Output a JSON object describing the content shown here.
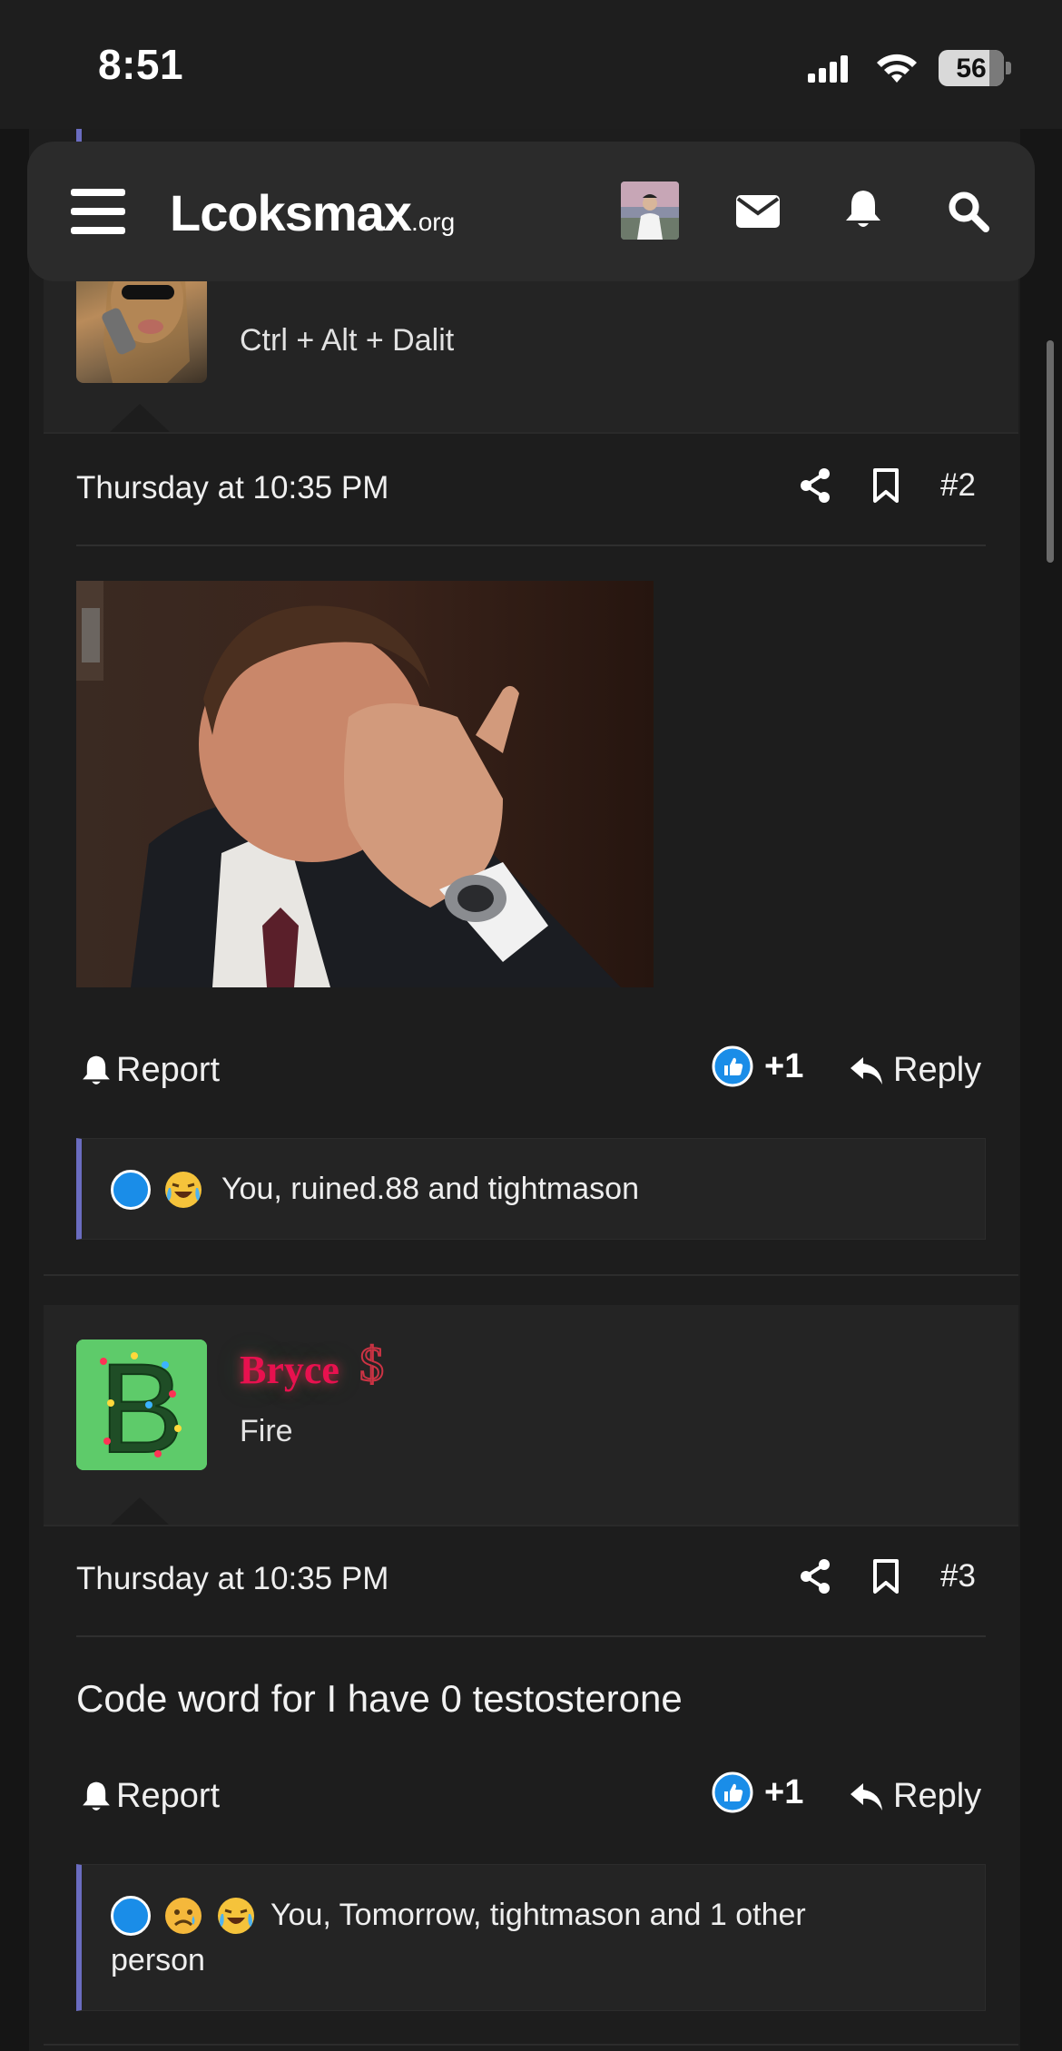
{
  "status": {
    "time": "8:51",
    "battery": "56"
  },
  "nav": {
    "logo_main": "Lcoksmax",
    "logo_suffix": ".org"
  },
  "post1": {
    "user_title": "Ctrl + Alt + Dalit"
  },
  "post2": {
    "timestamp": "Thursday at 10:35 PM",
    "number": "#2",
    "report_label": "Report",
    "like_count": "+1",
    "reply_label": "Reply",
    "reactions_text": "You, ruined.88 and tightmason"
  },
  "post3": {
    "username": "Bryce",
    "user_title": "Fire",
    "avatar_letter": "B",
    "timestamp": "Thursday at 10:35 PM",
    "number": "#3",
    "body": "Code word for I have 0 testosterone",
    "report_label": "Report",
    "like_count": "+1",
    "reply_label": "Reply",
    "reactions_line1": "You, Tomorrow, tightmason and 1 other",
    "reactions_line2": "person"
  },
  "colors": {
    "accent_bar": "#6a6cc0",
    "username": "#e8114f",
    "like_blue": "#1a8de8"
  }
}
